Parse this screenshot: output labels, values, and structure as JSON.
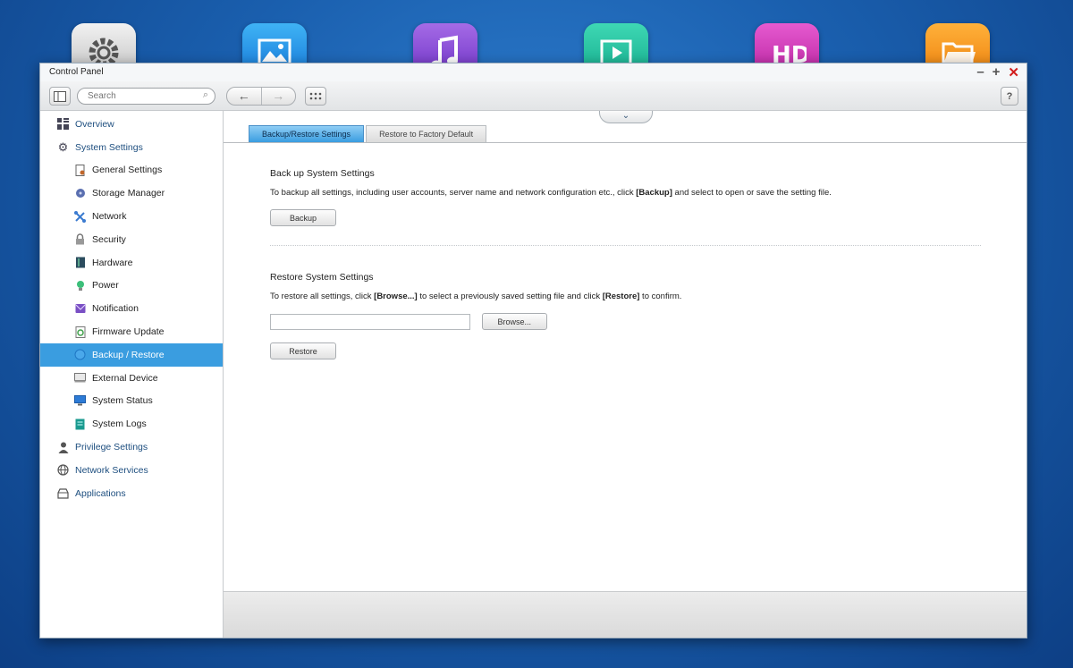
{
  "window": {
    "title": "Control Panel"
  },
  "toolbar": {
    "search_placeholder": "Search",
    "help_label": "?"
  },
  "sidebar": {
    "items": [
      {
        "label": "Overview",
        "level": "top",
        "icon": "grid-icon"
      },
      {
        "label": "System Settings",
        "level": "top",
        "icon": "gear-icon"
      },
      {
        "label": "General Settings",
        "level": "sub",
        "icon": "document-gear-icon"
      },
      {
        "label": "Storage Manager",
        "level": "sub",
        "icon": "storage-icon"
      },
      {
        "label": "Network",
        "level": "sub",
        "icon": "network-icon"
      },
      {
        "label": "Security",
        "level": "sub",
        "icon": "lock-icon"
      },
      {
        "label": "Hardware",
        "level": "sub",
        "icon": "hardware-icon"
      },
      {
        "label": "Power",
        "level": "sub",
        "icon": "power-bulb-icon"
      },
      {
        "label": "Notification",
        "level": "sub",
        "icon": "notification-icon"
      },
      {
        "label": "Firmware Update",
        "level": "sub",
        "icon": "firmware-icon"
      },
      {
        "label": "Backup / Restore",
        "level": "sub",
        "icon": "backup-icon",
        "selected": true
      },
      {
        "label": "External Device",
        "level": "sub",
        "icon": "external-device-icon"
      },
      {
        "label": "System Status",
        "level": "sub",
        "icon": "monitor-icon"
      },
      {
        "label": "System Logs",
        "level": "sub",
        "icon": "logs-icon"
      },
      {
        "label": "Privilege Settings",
        "level": "top",
        "icon": "user-icon"
      },
      {
        "label": "Network Services",
        "level": "top",
        "icon": "globe-icon"
      },
      {
        "label": "Applications",
        "level": "top",
        "icon": "applications-icon"
      }
    ]
  },
  "tabs": [
    {
      "label": "Backup/Restore Settings",
      "active": true
    },
    {
      "label": "Restore to Factory Default",
      "active": false
    }
  ],
  "backup": {
    "heading": "Back up System Settings",
    "desc_pre": "To backup all settings, including user accounts, server name and network configuration etc., click ",
    "desc_bold": "[Backup]",
    "desc_post": " and select to open or save the setting file.",
    "button": "Backup"
  },
  "restore": {
    "heading": "Restore System Settings",
    "desc_pre": "To restore all settings, click ",
    "desc_bold1": "[Browse...]",
    "desc_mid": " to select a previously saved setting file and click ",
    "desc_bold2": "[Restore]",
    "desc_post": " to confirm.",
    "file_value": "",
    "browse_button": "Browse...",
    "restore_button": "Restore"
  },
  "colors": {
    "accent": "#3a9de0",
    "close": "#d21d1d"
  }
}
